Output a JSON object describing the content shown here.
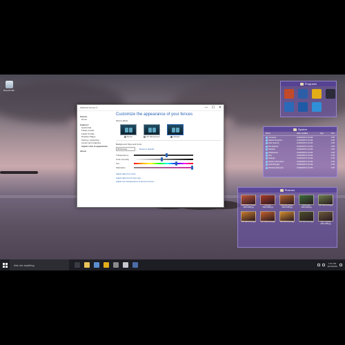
{
  "desktop": {
    "recycle_bin_label": "Recycle Bin"
  },
  "settings_window": {
    "title": "Stardock Fences 3",
    "controls": [
      "—",
      "☐",
      "✕"
    ],
    "sidebar": {
      "groups": [
        {
          "heading": "Fences",
          "items": [
            "Home"
          ]
        },
        {
          "heading": "Features",
          "items": [
            "Quick-hide",
            "Folder portals",
            "Folder Portals",
            "Desktop Pages",
            "Sorting / organizing",
            "Layout and snapping",
            "Adjust color & appearance"
          ]
        },
        {
          "heading": "About",
          "items": []
        }
      ],
      "selected": "Adjust color & appearance"
    },
    "main": {
      "title": "Customize the appearance of your fences",
      "show_labels_heading": "Show Labels",
      "label_options": [
        {
          "label": "Never",
          "selected": false
        },
        {
          "label": "On Mouseover",
          "selected": false
        },
        {
          "label": "Always",
          "selected": true
        }
      ],
      "bg_style_heading": "Background Style and Color",
      "fence_select": "All Fences",
      "reset_link": "Reset to default",
      "sliders": [
        {
          "label": "Transparency",
          "value": 0.55,
          "style": "plain"
        },
        {
          "label": "Color intensity",
          "value": 0.47,
          "style": "ci"
        },
        {
          "label": "Tint",
          "value": 0.72,
          "style": "hue"
        },
        {
          "label": "Saturation",
          "value": 0.98,
          "style": "sat"
        }
      ],
      "links": [
        "Adjust label text color...",
        "Adjust label font & font size...",
        "Adjust text transparency & Fences theme..."
      ]
    }
  },
  "fences": {
    "programs": {
      "title": "Programs",
      "icons": [
        {
          "name": "explorer-icon",
          "color": "#c24a2a"
        },
        {
          "name": "word-icon",
          "color": "#2c5ea8"
        },
        {
          "name": "chrome-icon",
          "color": "#e2ae18"
        },
        {
          "name": "fences-icon",
          "color": "#2b2b3a"
        },
        {
          "name": "app-icon",
          "color": "#2a6ab9"
        },
        {
          "name": "edge-icon",
          "color": "#1f5aa6"
        },
        {
          "name": "store-icon",
          "color": "#2f8fd8"
        }
      ]
    },
    "system": {
      "title": "System",
      "columns": [
        "Name",
        "Date modified",
        "Type",
        "Size"
      ],
      "rows": [
        [
          "Computer",
          "10/30/2015 3:31 AM",
          "",
          "1 KB"
        ],
        [
          "Default Programs",
          "10/30/2015 3:31 AM",
          "",
          "1 KB"
        ],
        [
          "Disk Cleanup",
          "10/30/2015 3:31 AM",
          "",
          "1 KB"
        ],
        [
          "File Explorer",
          "10/30/2015 3:31 AM",
          "",
          "1 KB"
        ],
        [
          "Network",
          "10/30/2015 3:31 AM",
          "",
          "1 KB"
        ],
        [
          "Notifications",
          "10/30/2015 3:31 AM",
          "",
          "1 KB"
        ],
        [
          "Run",
          "10/30/2015 3:31 AM",
          "",
          "1 KB"
        ],
        [
          "Settings",
          "10/30/2015 3:31 AM",
          "",
          "1 KB"
        ],
        [
          "System Information",
          "10/30/2015 3:31 AM",
          "",
          "1 KB"
        ],
        [
          "Task Manager",
          "10/30/2015 3:31 AM",
          "",
          "1 KB"
        ],
        [
          "Windows Defender",
          "10/30/2015 3:31 AM",
          "",
          "1 KB"
        ]
      ]
    },
    "pictures": {
      "title": "Pictures",
      "items": [
        {
          "caption": "Blue Beach Sunset 1920×1080.jpg",
          "color": "#c0553a"
        },
        {
          "caption": "Overlook 1920×1080.jpg",
          "color": "#a83a2a"
        },
        {
          "caption": "Mountain Lagoon 1920×1080.jpg",
          "color": "#b1612b"
        },
        {
          "caption": "Green Field 1920×1080.jpg",
          "color": "#3e6f3a"
        },
        {
          "caption": "Pier 1920×1080.jpg",
          "color": "#6c7f4a"
        },
        {
          "caption": "Pier 1920×1080.jpg",
          "color": "#c67a2a"
        },
        {
          "caption": "Pier 1920×1080.jpg",
          "color": "#c2602a"
        },
        {
          "caption": "Pier 1920×1080.jpg",
          "color": "#d18a2d"
        },
        {
          "caption": "Pier 1920×1080.jpg",
          "color": "#4b4f2a"
        },
        {
          "caption": "Pier – Sunrise 1920×1080.jpg",
          "color": "#6a5a3a"
        }
      ]
    }
  },
  "taskbar": {
    "search_placeholder": "Ask me anything",
    "pinned": [
      {
        "name": "task-view-icon",
        "color": "#3b3b44"
      },
      {
        "name": "folder-icon",
        "color": "#e8c25a"
      },
      {
        "name": "store-icon",
        "color": "#5a8fd0"
      },
      {
        "name": "chrome-icon",
        "color": "#e2ae18"
      },
      {
        "name": "settings-icon",
        "color": "#8a8a8a"
      },
      {
        "name": "app-icon",
        "color": "#c7c7d0"
      },
      {
        "name": "fences-icon",
        "color": "#4c6ea8"
      }
    ],
    "time": "1:51 PM",
    "date": "11/15/2015"
  }
}
